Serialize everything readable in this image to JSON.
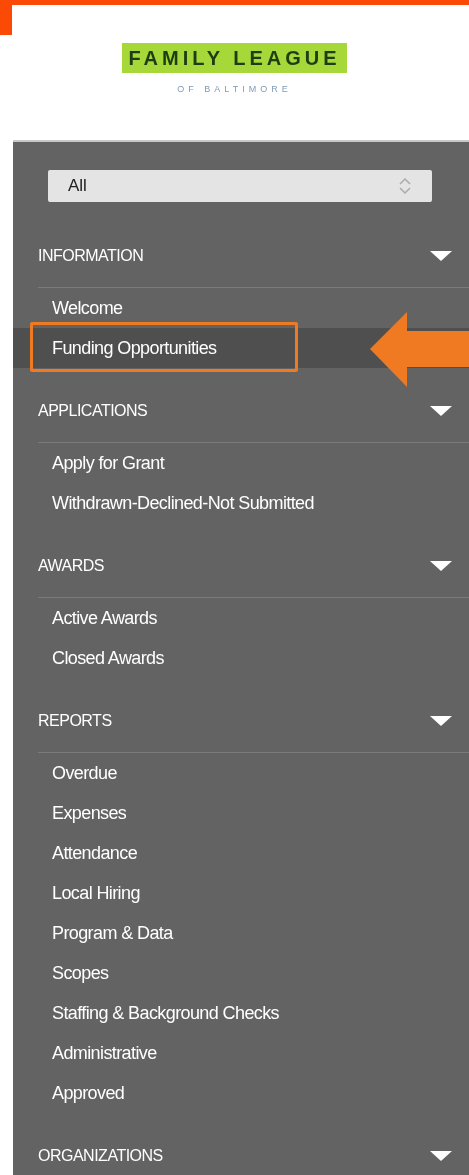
{
  "logo": {
    "title": "FAMILY LEAGUE",
    "subtitle": "OF BALTIMORE"
  },
  "filter": {
    "value": "All"
  },
  "sections": [
    {
      "title": "INFORMATION",
      "expanded": true,
      "items": [
        {
          "label": "Welcome",
          "selected": false,
          "highlighted": false
        },
        {
          "label": "Funding Opportunities",
          "selected": true,
          "highlighted": true
        }
      ]
    },
    {
      "title": "APPLICATIONS",
      "expanded": true,
      "items": [
        {
          "label": "Apply for Grant",
          "selected": false,
          "highlighted": false
        },
        {
          "label": "Withdrawn-Declined-Not Submitted",
          "selected": false,
          "highlighted": false
        }
      ]
    },
    {
      "title": "AWARDS",
      "expanded": true,
      "items": [
        {
          "label": "Active Awards",
          "selected": false,
          "highlighted": false
        },
        {
          "label": "Closed Awards",
          "selected": false,
          "highlighted": false
        }
      ]
    },
    {
      "title": "REPORTS",
      "expanded": true,
      "items": [
        {
          "label": "Overdue",
          "selected": false,
          "highlighted": false
        },
        {
          "label": "Expenses",
          "selected": false,
          "highlighted": false
        },
        {
          "label": "Attendance",
          "selected": false,
          "highlighted": false
        },
        {
          "label": "Local Hiring",
          "selected": false,
          "highlighted": false
        },
        {
          "label": "Program & Data",
          "selected": false,
          "highlighted": false
        },
        {
          "label": "Scopes",
          "selected": false,
          "highlighted": false
        },
        {
          "label": "Staffing & Background Checks",
          "selected": false,
          "highlighted": false
        },
        {
          "label": "Administrative",
          "selected": false,
          "highlighted": false
        },
        {
          "label": "Approved",
          "selected": false,
          "highlighted": false
        }
      ]
    },
    {
      "title": "ORGANIZATIONS",
      "expanded": true
    }
  ]
}
